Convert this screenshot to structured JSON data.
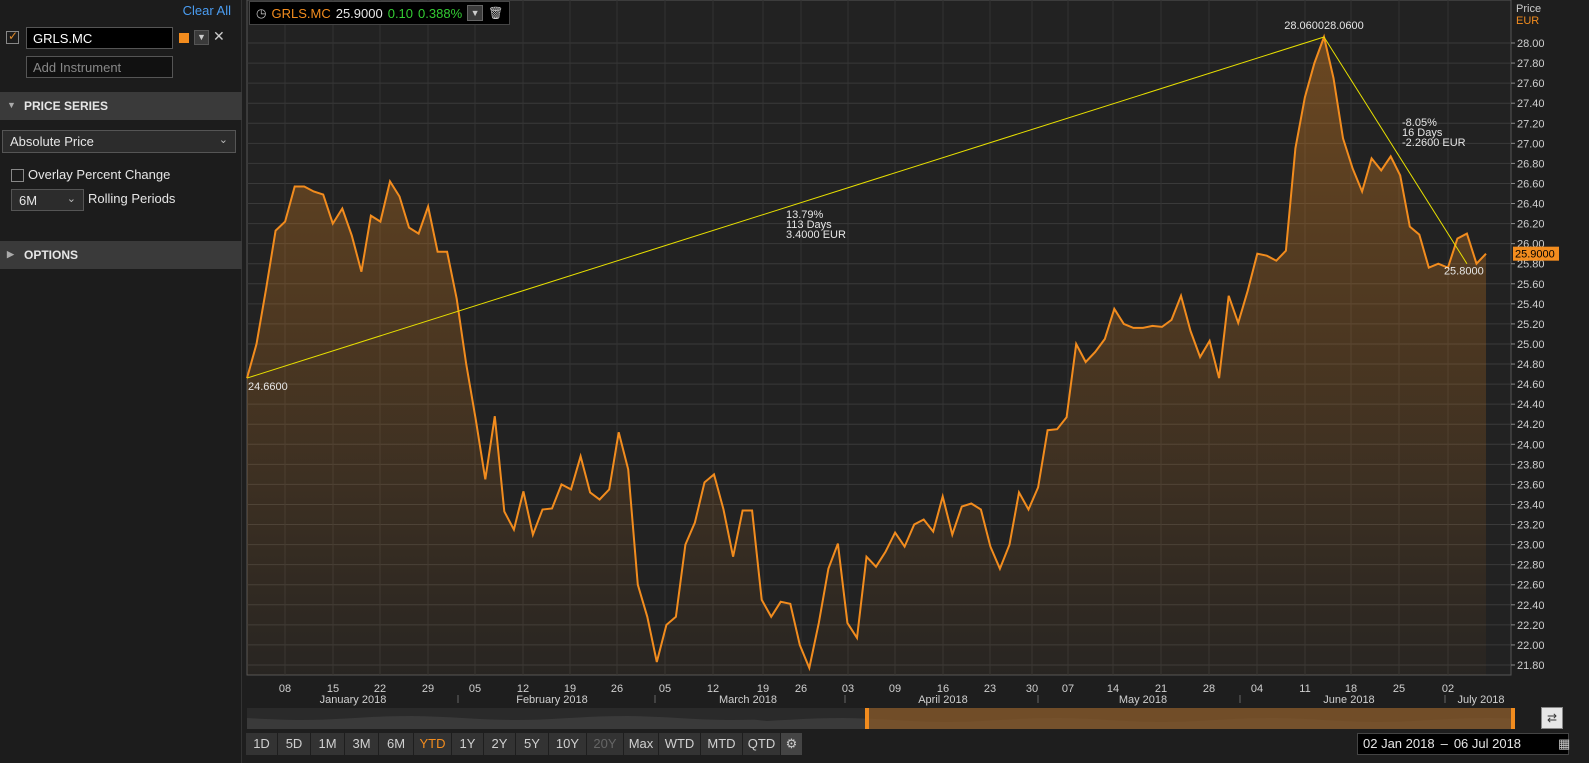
{
  "sidebar": {
    "clear_all": "Clear All",
    "instrument": {
      "symbol": "GRLS.MC",
      "color": "#f28c1e"
    },
    "add_instrument_placeholder": "Add Instrument",
    "price_series": {
      "header": "PRICE SERIES",
      "mode": "Absolute Price",
      "overlay_label": "Overlay Percent Change",
      "rolling_period": "6M",
      "rolling_label": "Rolling Periods"
    },
    "options_header": "OPTIONS"
  },
  "toolbar": {
    "symbol": "GRLS.MC",
    "last": "25.9000",
    "change": "0.10",
    "pct_change": "0.388%"
  },
  "price_axis": {
    "title": "Price",
    "currency": "EUR"
  },
  "period_buttons": [
    {
      "label": "1D",
      "state": "normal"
    },
    {
      "label": "5D",
      "state": "normal"
    },
    {
      "label": "1M",
      "state": "normal"
    },
    {
      "label": "3M",
      "state": "normal"
    },
    {
      "label": "6M",
      "state": "normal"
    },
    {
      "label": "YTD",
      "state": "active"
    },
    {
      "label": "1Y",
      "state": "normal"
    },
    {
      "label": "2Y",
      "state": "normal"
    },
    {
      "label": "5Y",
      "state": "normal"
    },
    {
      "label": "10Y",
      "state": "normal"
    },
    {
      "label": "20Y",
      "state": "disabled"
    },
    {
      "label": "Max",
      "state": "normal"
    },
    {
      "label": "WTD",
      "state": "normal"
    },
    {
      "label": "MTD",
      "state": "normal"
    },
    {
      "label": "QTD",
      "state": "normal"
    }
  ],
  "date_range": {
    "from": "02 Jan 2018",
    "to": "06 Jul 2018"
  },
  "chart_data": {
    "type": "line",
    "series": [
      {
        "name": "GRLS.MC",
        "color": "#f28c1e",
        "values": [
          24.66,
          25.0,
          25.55,
          26.13,
          26.22,
          26.57,
          26.57,
          26.52,
          26.49,
          26.2,
          26.35,
          26.08,
          25.72,
          26.28,
          26.22,
          26.62,
          26.47,
          26.16,
          26.1,
          26.37,
          25.92,
          25.92,
          25.45,
          24.8,
          24.25,
          23.65,
          24.28,
          23.33,
          23.15,
          23.53,
          23.1,
          23.35,
          23.36,
          23.6,
          23.55,
          23.88,
          23.52,
          23.45,
          23.55,
          24.12,
          23.75,
          22.6,
          22.28,
          21.83,
          22.2,
          22.28,
          23.0,
          23.22,
          23.62,
          23.7,
          23.35,
          22.88,
          23.34,
          23.34,
          22.45,
          22.28,
          22.43,
          22.41,
          22.0,
          21.77,
          22.22,
          22.76,
          23.01,
          22.22,
          22.07,
          22.88,
          22.78,
          22.93,
          23.12,
          22.98,
          23.2,
          23.25,
          23.13,
          23.48,
          23.1,
          23.38,
          23.41,
          23.35,
          22.98,
          22.76,
          23.0,
          23.52,
          23.35,
          23.57,
          24.14,
          24.15,
          24.27,
          25.0,
          24.82,
          24.92,
          25.05,
          25.35,
          25.2,
          25.16,
          25.16,
          25.18,
          25.17,
          25.24,
          25.48,
          25.13,
          24.87,
          25.03,
          24.66,
          25.48,
          25.21,
          25.53,
          25.9,
          25.88,
          25.83,
          25.93,
          26.95,
          27.46,
          27.8,
          28.06,
          27.65,
          27.05,
          26.75,
          26.52,
          26.85,
          26.73,
          26.87,
          26.68,
          26.17,
          26.09,
          25.76,
          25.8,
          25.76,
          26.05,
          26.1,
          25.8,
          25.9
        ],
        "x_start": "2018-01-02",
        "x_end": "2018-07-06"
      }
    ],
    "ylim": [
      21.8,
      28.2
    ],
    "yticks": [
      "21.80",
      "22.00",
      "22.20",
      "22.40",
      "22.60",
      "22.80",
      "23.00",
      "23.20",
      "23.40",
      "23.60",
      "23.80",
      "24.00",
      "24.20",
      "24.40",
      "24.60",
      "24.80",
      "25.00",
      "25.20",
      "25.40",
      "25.60",
      "25.80",
      "26.00",
      "26.20",
      "26.40",
      "26.60",
      "26.80",
      "27.00",
      "27.20",
      "27.40",
      "27.60",
      "27.80",
      "28.00"
    ],
    "xticks": [
      "08",
      "15",
      "22",
      "29",
      "05",
      "12",
      "19",
      "26",
      "05",
      "12",
      "19",
      "26",
      "03",
      "09",
      "16",
      "23",
      "30",
      "07",
      "14",
      "21",
      "28",
      "04",
      "11",
      "18",
      "25",
      "02"
    ],
    "months": [
      "January 2018",
      "February 2018",
      "March 2018",
      "April 2018",
      "May 2018",
      "June 2018",
      "July 2018"
    ],
    "last_value_label": "25.9000",
    "annotations": {
      "start_label": "24.6600",
      "peak_label": "28.060028.0600",
      "end_label": "25.8000",
      "trend1": [
        "13.79%",
        "113 Days",
        "3.4000 EUR"
      ],
      "trend2": [
        "-8.05%",
        "16 Days",
        "-2.2600 EUR"
      ]
    },
    "grid": true
  }
}
